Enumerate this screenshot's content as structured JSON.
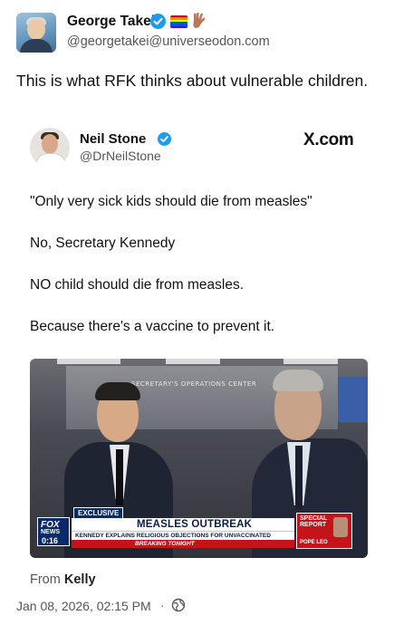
{
  "author": {
    "name": "George Takei",
    "handle": "@georgetakei@universeodon.com"
  },
  "post": {
    "text": "This is what RFK thinks about vulnerable children."
  },
  "quoted": {
    "name": "Neil Stone",
    "handle": "@DrNeilStone",
    "site": "X.com",
    "lines": [
      "\"Only very sick kids should die from measles\"",
      "No, Secretary Kennedy",
      "NO child should die from measles.",
      "Because there's a vaccine to prevent it."
    ],
    "video": {
      "room_sign": "SECRETARY'S OPERATIONS CENTER",
      "exclusive": "EXCLUSIVE",
      "network": "FOX",
      "network_sub": "NEWS",
      "timestamp": "0:16",
      "headline": "MEASLES OUTBREAK",
      "subline": "KENNEDY EXPLAINS RELIGIOUS OBJECTIONS FOR UNVACCINATED",
      "ticker": "BREAKING TONIGHT",
      "special": "SPECIAL REPORT",
      "special_sub": "POPE LEO"
    }
  },
  "meta": {
    "from_label": "From",
    "from_name": "Kelly",
    "date": "Jan 08, 2026, 02:15 PM",
    "separator": "·"
  },
  "colors": {
    "verified": "#1d9bf0",
    "fox_blue": "#0a2a6b",
    "fox_red": "#c4141b"
  }
}
